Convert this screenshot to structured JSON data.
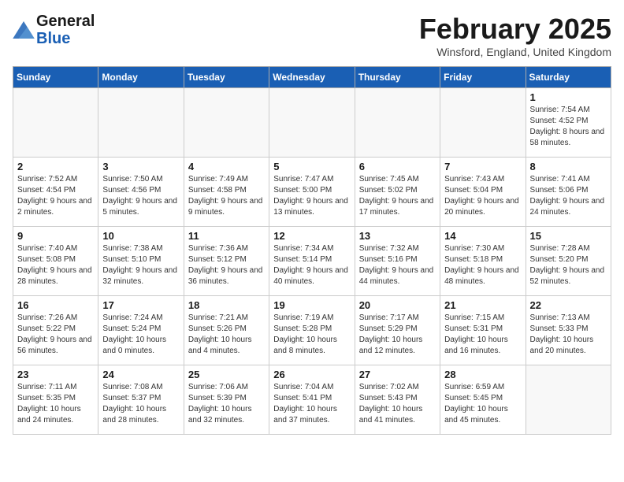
{
  "header": {
    "logo_text_general": "General",
    "logo_text_blue": "Blue",
    "month_title": "February 2025",
    "location": "Winsford, England, United Kingdom"
  },
  "days_of_week": [
    "Sunday",
    "Monday",
    "Tuesday",
    "Wednesday",
    "Thursday",
    "Friday",
    "Saturday"
  ],
  "weeks": [
    [
      {
        "day": "",
        "info": ""
      },
      {
        "day": "",
        "info": ""
      },
      {
        "day": "",
        "info": ""
      },
      {
        "day": "",
        "info": ""
      },
      {
        "day": "",
        "info": ""
      },
      {
        "day": "",
        "info": ""
      },
      {
        "day": "1",
        "info": "Sunrise: 7:54 AM\nSunset: 4:52 PM\nDaylight: 8 hours and 58 minutes."
      }
    ],
    [
      {
        "day": "2",
        "info": "Sunrise: 7:52 AM\nSunset: 4:54 PM\nDaylight: 9 hours and 2 minutes."
      },
      {
        "day": "3",
        "info": "Sunrise: 7:50 AM\nSunset: 4:56 PM\nDaylight: 9 hours and 5 minutes."
      },
      {
        "day": "4",
        "info": "Sunrise: 7:49 AM\nSunset: 4:58 PM\nDaylight: 9 hours and 9 minutes."
      },
      {
        "day": "5",
        "info": "Sunrise: 7:47 AM\nSunset: 5:00 PM\nDaylight: 9 hours and 13 minutes."
      },
      {
        "day": "6",
        "info": "Sunrise: 7:45 AM\nSunset: 5:02 PM\nDaylight: 9 hours and 17 minutes."
      },
      {
        "day": "7",
        "info": "Sunrise: 7:43 AM\nSunset: 5:04 PM\nDaylight: 9 hours and 20 minutes."
      },
      {
        "day": "8",
        "info": "Sunrise: 7:41 AM\nSunset: 5:06 PM\nDaylight: 9 hours and 24 minutes."
      }
    ],
    [
      {
        "day": "9",
        "info": "Sunrise: 7:40 AM\nSunset: 5:08 PM\nDaylight: 9 hours and 28 minutes."
      },
      {
        "day": "10",
        "info": "Sunrise: 7:38 AM\nSunset: 5:10 PM\nDaylight: 9 hours and 32 minutes."
      },
      {
        "day": "11",
        "info": "Sunrise: 7:36 AM\nSunset: 5:12 PM\nDaylight: 9 hours and 36 minutes."
      },
      {
        "day": "12",
        "info": "Sunrise: 7:34 AM\nSunset: 5:14 PM\nDaylight: 9 hours and 40 minutes."
      },
      {
        "day": "13",
        "info": "Sunrise: 7:32 AM\nSunset: 5:16 PM\nDaylight: 9 hours and 44 minutes."
      },
      {
        "day": "14",
        "info": "Sunrise: 7:30 AM\nSunset: 5:18 PM\nDaylight: 9 hours and 48 minutes."
      },
      {
        "day": "15",
        "info": "Sunrise: 7:28 AM\nSunset: 5:20 PM\nDaylight: 9 hours and 52 minutes."
      }
    ],
    [
      {
        "day": "16",
        "info": "Sunrise: 7:26 AM\nSunset: 5:22 PM\nDaylight: 9 hours and 56 minutes."
      },
      {
        "day": "17",
        "info": "Sunrise: 7:24 AM\nSunset: 5:24 PM\nDaylight: 10 hours and 0 minutes."
      },
      {
        "day": "18",
        "info": "Sunrise: 7:21 AM\nSunset: 5:26 PM\nDaylight: 10 hours and 4 minutes."
      },
      {
        "day": "19",
        "info": "Sunrise: 7:19 AM\nSunset: 5:28 PM\nDaylight: 10 hours and 8 minutes."
      },
      {
        "day": "20",
        "info": "Sunrise: 7:17 AM\nSunset: 5:29 PM\nDaylight: 10 hours and 12 minutes."
      },
      {
        "day": "21",
        "info": "Sunrise: 7:15 AM\nSunset: 5:31 PM\nDaylight: 10 hours and 16 minutes."
      },
      {
        "day": "22",
        "info": "Sunrise: 7:13 AM\nSunset: 5:33 PM\nDaylight: 10 hours and 20 minutes."
      }
    ],
    [
      {
        "day": "23",
        "info": "Sunrise: 7:11 AM\nSunset: 5:35 PM\nDaylight: 10 hours and 24 minutes."
      },
      {
        "day": "24",
        "info": "Sunrise: 7:08 AM\nSunset: 5:37 PM\nDaylight: 10 hours and 28 minutes."
      },
      {
        "day": "25",
        "info": "Sunrise: 7:06 AM\nSunset: 5:39 PM\nDaylight: 10 hours and 32 minutes."
      },
      {
        "day": "26",
        "info": "Sunrise: 7:04 AM\nSunset: 5:41 PM\nDaylight: 10 hours and 37 minutes."
      },
      {
        "day": "27",
        "info": "Sunrise: 7:02 AM\nSunset: 5:43 PM\nDaylight: 10 hours and 41 minutes."
      },
      {
        "day": "28",
        "info": "Sunrise: 6:59 AM\nSunset: 5:45 PM\nDaylight: 10 hours and 45 minutes."
      },
      {
        "day": "",
        "info": ""
      }
    ]
  ]
}
